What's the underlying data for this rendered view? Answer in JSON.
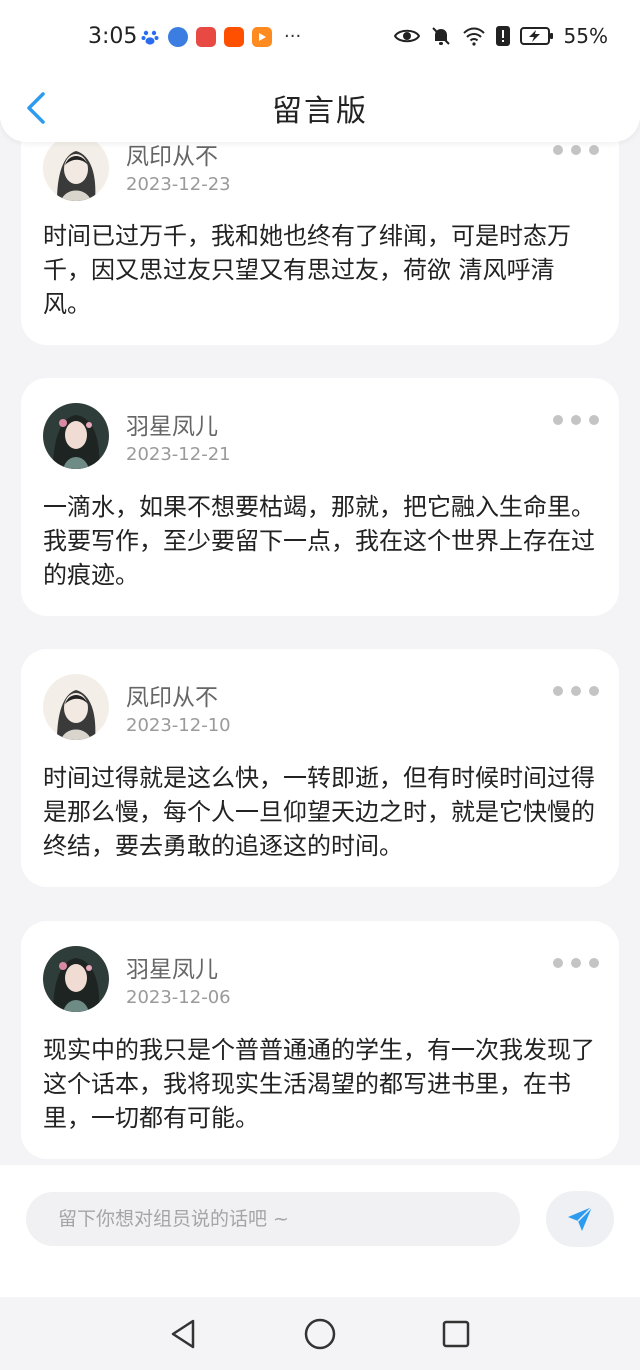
{
  "status_bar": {
    "time": "3:05",
    "more": "···",
    "battery_percent": "55%",
    "app_icons": [
      {
        "name": "baidu-paw-icon",
        "color": "#2a6cf0"
      },
      {
        "name": "app-circle-icon",
        "color": "#3b7de0"
      },
      {
        "name": "app-red-square-icon",
        "color": "#e84a43"
      },
      {
        "name": "taobao-icon",
        "color": "#ff5000"
      },
      {
        "name": "video-play-icon",
        "color": "#ff8a1f"
      }
    ]
  },
  "header": {
    "title": "留言版"
  },
  "messages": [
    {
      "author": "凤印从不",
      "date": "2023-12-23",
      "text": "时间已过万千，我和她也终有了绯闻，可是时态万千，因又思过友只望又有思过友，荷欲 清风呼清风。"
    },
    {
      "author": "羽星凤儿",
      "date": "2023-12-21",
      "text": "一滴水，如果不想要枯竭，那就，把它融入生命里。我要写作，至少要留下一点，我在这个世界上存在过的痕迹。"
    },
    {
      "author": "凤印从不",
      "date": "2023-12-10",
      "text": "时间过得就是这么快，一转即逝，但有时候时间过得是那么慢，每个人一旦仰望天边之时，就是它快慢的终结，要去勇敢的追逐这的时间。"
    },
    {
      "author": "羽星凤儿",
      "date": "2023-12-06",
      "text": "现实中的我只是个普普通通的学生，有一次我发现了这个话本，我将现实生活渴望的都写进书里，在书里，一切都有可能。"
    }
  ],
  "input": {
    "placeholder": "留下你想对组员说的话吧 ~",
    "value": ""
  },
  "colors": {
    "accent": "#2d9cf0",
    "background": "#f4f4f6",
    "card": "#ffffff"
  }
}
